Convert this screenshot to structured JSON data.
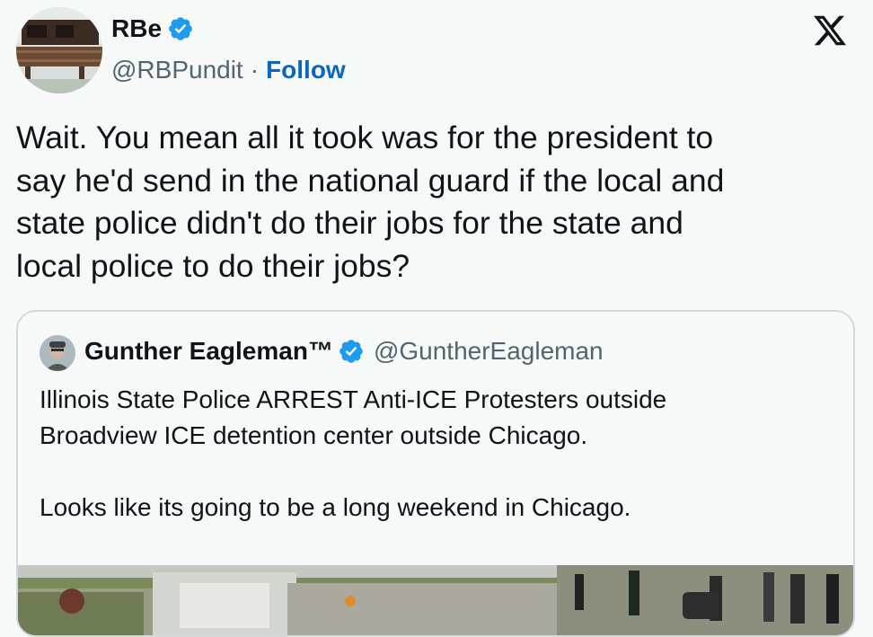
{
  "author": {
    "display_name": "RBe",
    "handle": "@RBPundit",
    "separator": "·",
    "follow_label": "Follow",
    "verified_icon": "verified-badge-icon"
  },
  "header": {
    "logo_icon": "x-logo-icon"
  },
  "tweet": {
    "text": "Wait. You mean all it took was for the president to\nsay he'd send in the national guard if the local and\nstate police didn't do their jobs for the state and\nlocal police to do their jobs?"
  },
  "quoted_tweet": {
    "display_name": "Gunther Eagleman™",
    "handle": "@GuntherEagleman",
    "text": "Illinois State Police ARREST Anti-ICE Protesters outside\nBroadview ICE detention center outside Chicago.\n\nLooks like its going to be a long weekend in Chicago.",
    "media_icon": "photo-media"
  },
  "colors": {
    "accent": "#1d9bf0",
    "follow": "#0b66c2",
    "secondary_text": "#536471",
    "background": "#f7f9f9"
  }
}
